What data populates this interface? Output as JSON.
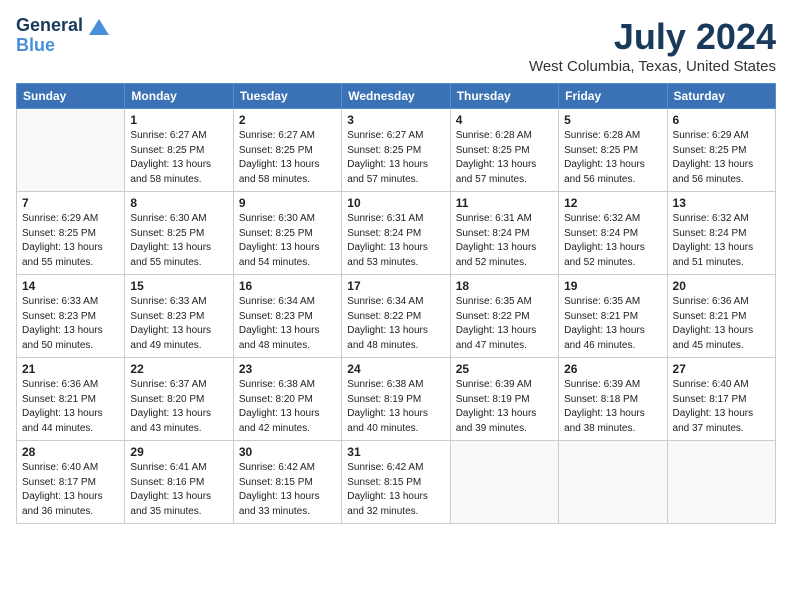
{
  "header": {
    "logo_line1": "General",
    "logo_line2": "Blue",
    "month_title": "July 2024",
    "location": "West Columbia, Texas, United States"
  },
  "weekdays": [
    "Sunday",
    "Monday",
    "Tuesday",
    "Wednesday",
    "Thursday",
    "Friday",
    "Saturday"
  ],
  "weeks": [
    [
      {
        "day": "",
        "sunrise": "",
        "sunset": "",
        "daylight": ""
      },
      {
        "day": "1",
        "sunrise": "6:27 AM",
        "sunset": "8:25 PM",
        "daylight": "13 hours and 58 minutes."
      },
      {
        "day": "2",
        "sunrise": "6:27 AM",
        "sunset": "8:25 PM",
        "daylight": "13 hours and 58 minutes."
      },
      {
        "day": "3",
        "sunrise": "6:27 AM",
        "sunset": "8:25 PM",
        "daylight": "13 hours and 57 minutes."
      },
      {
        "day": "4",
        "sunrise": "6:28 AM",
        "sunset": "8:25 PM",
        "daylight": "13 hours and 57 minutes."
      },
      {
        "day": "5",
        "sunrise": "6:28 AM",
        "sunset": "8:25 PM",
        "daylight": "13 hours and 56 minutes."
      },
      {
        "day": "6",
        "sunrise": "6:29 AM",
        "sunset": "8:25 PM",
        "daylight": "13 hours and 56 minutes."
      }
    ],
    [
      {
        "day": "7",
        "sunrise": "6:29 AM",
        "sunset": "8:25 PM",
        "daylight": "13 hours and 55 minutes."
      },
      {
        "day": "8",
        "sunrise": "6:30 AM",
        "sunset": "8:25 PM",
        "daylight": "13 hours and 55 minutes."
      },
      {
        "day": "9",
        "sunrise": "6:30 AM",
        "sunset": "8:25 PM",
        "daylight": "13 hours and 54 minutes."
      },
      {
        "day": "10",
        "sunrise": "6:31 AM",
        "sunset": "8:24 PM",
        "daylight": "13 hours and 53 minutes."
      },
      {
        "day": "11",
        "sunrise": "6:31 AM",
        "sunset": "8:24 PM",
        "daylight": "13 hours and 52 minutes."
      },
      {
        "day": "12",
        "sunrise": "6:32 AM",
        "sunset": "8:24 PM",
        "daylight": "13 hours and 52 minutes."
      },
      {
        "day": "13",
        "sunrise": "6:32 AM",
        "sunset": "8:24 PM",
        "daylight": "13 hours and 51 minutes."
      }
    ],
    [
      {
        "day": "14",
        "sunrise": "6:33 AM",
        "sunset": "8:23 PM",
        "daylight": "13 hours and 50 minutes."
      },
      {
        "day": "15",
        "sunrise": "6:33 AM",
        "sunset": "8:23 PM",
        "daylight": "13 hours and 49 minutes."
      },
      {
        "day": "16",
        "sunrise": "6:34 AM",
        "sunset": "8:23 PM",
        "daylight": "13 hours and 48 minutes."
      },
      {
        "day": "17",
        "sunrise": "6:34 AM",
        "sunset": "8:22 PM",
        "daylight": "13 hours and 48 minutes."
      },
      {
        "day": "18",
        "sunrise": "6:35 AM",
        "sunset": "8:22 PM",
        "daylight": "13 hours and 47 minutes."
      },
      {
        "day": "19",
        "sunrise": "6:35 AM",
        "sunset": "8:21 PM",
        "daylight": "13 hours and 46 minutes."
      },
      {
        "day": "20",
        "sunrise": "6:36 AM",
        "sunset": "8:21 PM",
        "daylight": "13 hours and 45 minutes."
      }
    ],
    [
      {
        "day": "21",
        "sunrise": "6:36 AM",
        "sunset": "8:21 PM",
        "daylight": "13 hours and 44 minutes."
      },
      {
        "day": "22",
        "sunrise": "6:37 AM",
        "sunset": "8:20 PM",
        "daylight": "13 hours and 43 minutes."
      },
      {
        "day": "23",
        "sunrise": "6:38 AM",
        "sunset": "8:20 PM",
        "daylight": "13 hours and 42 minutes."
      },
      {
        "day": "24",
        "sunrise": "6:38 AM",
        "sunset": "8:19 PM",
        "daylight": "13 hours and 40 minutes."
      },
      {
        "day": "25",
        "sunrise": "6:39 AM",
        "sunset": "8:19 PM",
        "daylight": "13 hours and 39 minutes."
      },
      {
        "day": "26",
        "sunrise": "6:39 AM",
        "sunset": "8:18 PM",
        "daylight": "13 hours and 38 minutes."
      },
      {
        "day": "27",
        "sunrise": "6:40 AM",
        "sunset": "8:17 PM",
        "daylight": "13 hours and 37 minutes."
      }
    ],
    [
      {
        "day": "28",
        "sunrise": "6:40 AM",
        "sunset": "8:17 PM",
        "daylight": "13 hours and 36 minutes."
      },
      {
        "day": "29",
        "sunrise": "6:41 AM",
        "sunset": "8:16 PM",
        "daylight": "13 hours and 35 minutes."
      },
      {
        "day": "30",
        "sunrise": "6:42 AM",
        "sunset": "8:15 PM",
        "daylight": "13 hours and 33 minutes."
      },
      {
        "day": "31",
        "sunrise": "6:42 AM",
        "sunset": "8:15 PM",
        "daylight": "13 hours and 32 minutes."
      },
      {
        "day": "",
        "sunrise": "",
        "sunset": "",
        "daylight": ""
      },
      {
        "day": "",
        "sunrise": "",
        "sunset": "",
        "daylight": ""
      },
      {
        "day": "",
        "sunrise": "",
        "sunset": "",
        "daylight": ""
      }
    ]
  ],
  "labels": {
    "sunrise": "Sunrise:",
    "sunset": "Sunset:",
    "daylight": "Daylight:"
  }
}
